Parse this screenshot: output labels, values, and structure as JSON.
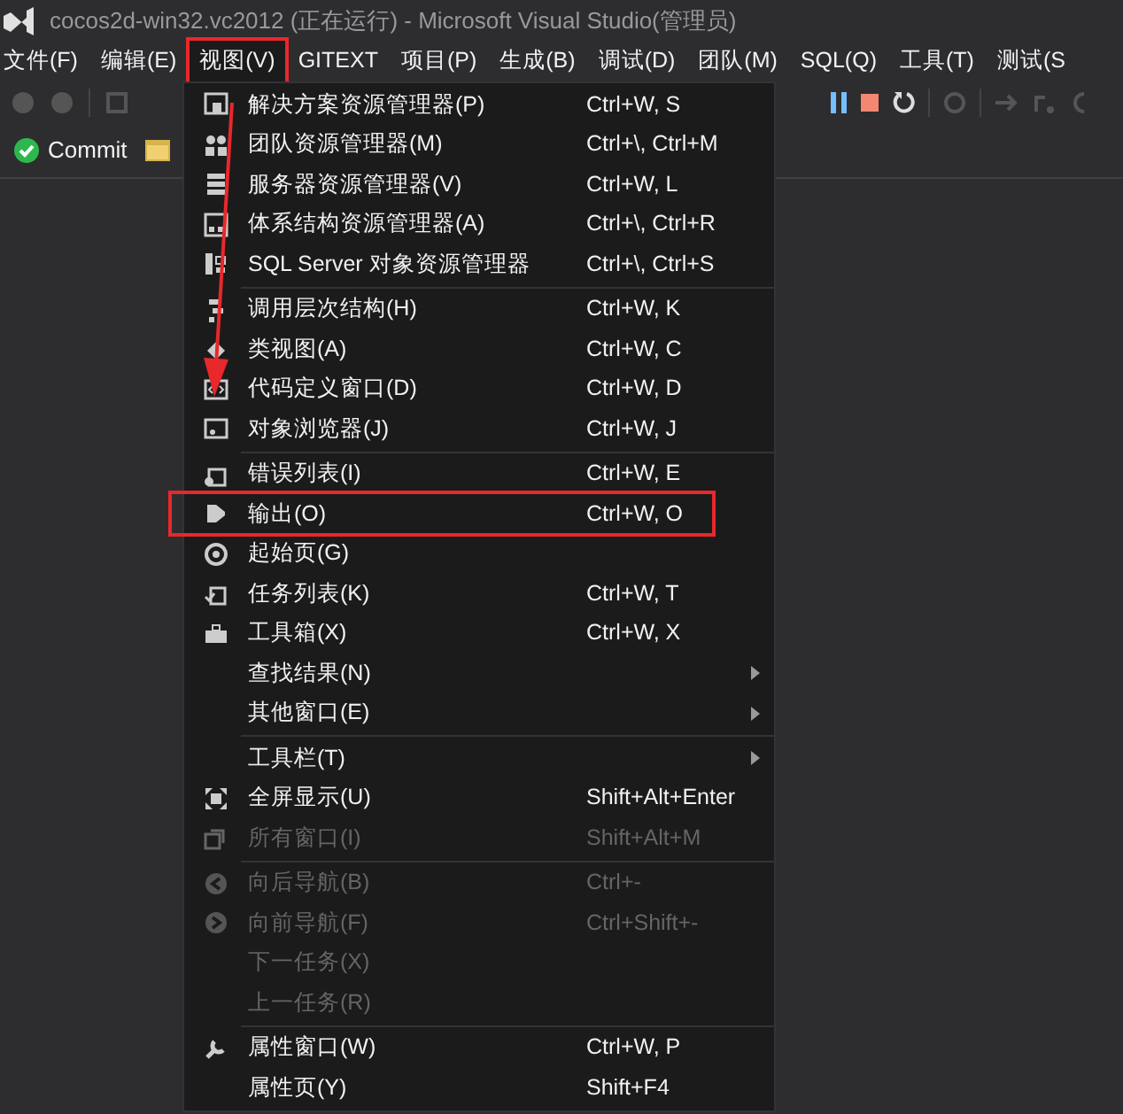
{
  "window": {
    "title": "cocos2d-win32.vc2012 (正在运行) - Microsoft Visual Studio(管理员)"
  },
  "menu_bar": [
    {
      "label": "文件(F)",
      "selected": false,
      "annotated": false
    },
    {
      "label": "编辑(E)",
      "selected": false,
      "annotated": false
    },
    {
      "label": "视图(V)",
      "selected": true,
      "annotated": true
    },
    {
      "label": "GITEXT",
      "selected": false,
      "annotated": false
    },
    {
      "label": "项目(P)",
      "selected": false,
      "annotated": false
    },
    {
      "label": "生成(B)",
      "selected": false,
      "annotated": false
    },
    {
      "label": "调试(D)",
      "selected": false,
      "annotated": false
    },
    {
      "label": "团队(M)",
      "selected": false,
      "annotated": false
    },
    {
      "label": "SQL(Q)",
      "selected": false,
      "annotated": false
    },
    {
      "label": "工具(T)",
      "selected": false,
      "annotated": false
    },
    {
      "label": "测试(S",
      "selected": false,
      "annotated": false
    }
  ],
  "toolbar": {
    "commit": "Commit"
  },
  "menu": {
    "items": [
      {
        "kind": "item",
        "label": "解决方案资源管理器(P)",
        "shortcut": "Ctrl+W, S",
        "disabled": false,
        "submenu": false,
        "annotated": false
      },
      {
        "kind": "item",
        "label": "团队资源管理器(M)",
        "shortcut": "Ctrl+\\, Ctrl+M",
        "disabled": false,
        "submenu": false,
        "annotated": false
      },
      {
        "kind": "item",
        "label": "服务器资源管理器(V)",
        "shortcut": "Ctrl+W, L",
        "disabled": false,
        "submenu": false,
        "annotated": false
      },
      {
        "kind": "item",
        "label": "体系结构资源管理器(A)",
        "shortcut": "Ctrl+\\, Ctrl+R",
        "disabled": false,
        "submenu": false,
        "annotated": false
      },
      {
        "kind": "item",
        "label": "SQL Server 对象资源管理器",
        "shortcut": "Ctrl+\\, Ctrl+S",
        "disabled": false,
        "submenu": false,
        "annotated": false
      },
      {
        "kind": "separator"
      },
      {
        "kind": "item",
        "label": "调用层次结构(H)",
        "shortcut": "Ctrl+W, K",
        "disabled": false,
        "submenu": false,
        "annotated": false
      },
      {
        "kind": "item",
        "label": "类视图(A)",
        "shortcut": "Ctrl+W, C",
        "disabled": false,
        "submenu": false,
        "annotated": false
      },
      {
        "kind": "item",
        "label": "代码定义窗口(D)",
        "shortcut": "Ctrl+W, D",
        "disabled": false,
        "submenu": false,
        "annotated": false
      },
      {
        "kind": "item",
        "label": "对象浏览器(J)",
        "shortcut": "Ctrl+W, J",
        "disabled": false,
        "submenu": false,
        "annotated": false
      },
      {
        "kind": "separator"
      },
      {
        "kind": "item",
        "label": "错误列表(I)",
        "shortcut": "Ctrl+W, E",
        "disabled": false,
        "submenu": false,
        "annotated": false
      },
      {
        "kind": "item",
        "label": "输出(O)",
        "shortcut": "Ctrl+W, O",
        "disabled": false,
        "submenu": false,
        "annotated": true
      },
      {
        "kind": "item",
        "label": "起始页(G)",
        "disabled": false,
        "submenu": false,
        "annotated": false
      },
      {
        "kind": "item",
        "label": "任务列表(K)",
        "shortcut": "Ctrl+W, T",
        "disabled": false,
        "submenu": false,
        "annotated": false
      },
      {
        "kind": "item",
        "label": "工具箱(X)",
        "shortcut": "Ctrl+W, X",
        "disabled": false,
        "submenu": false,
        "annotated": false
      },
      {
        "kind": "item",
        "label": "查找结果(N)",
        "disabled": false,
        "submenu": true,
        "annotated": false
      },
      {
        "kind": "item",
        "label": "其他窗口(E)",
        "disabled": false,
        "submenu": true,
        "annotated": false
      },
      {
        "kind": "separator"
      },
      {
        "kind": "item",
        "label": "工具栏(T)",
        "disabled": false,
        "submenu": true,
        "annotated": false
      },
      {
        "kind": "item",
        "label": "全屏显示(U)",
        "shortcut": "Shift+Alt+Enter",
        "disabled": false,
        "submenu": false,
        "annotated": false
      },
      {
        "kind": "item",
        "label": "所有窗口(I)",
        "shortcut": "Shift+Alt+M",
        "disabled": true,
        "submenu": false,
        "annotated": false
      },
      {
        "kind": "separator"
      },
      {
        "kind": "item",
        "label": "向后导航(B)",
        "shortcut": "Ctrl+-",
        "disabled": true,
        "submenu": false,
        "annotated": false
      },
      {
        "kind": "item",
        "label": "向前导航(F)",
        "shortcut": "Ctrl+Shift+-",
        "disabled": true,
        "submenu": false,
        "annotated": false
      },
      {
        "kind": "item",
        "label": "下一任务(X)",
        "disabled": true,
        "submenu": false,
        "annotated": false
      },
      {
        "kind": "item",
        "label": "上一任务(R)",
        "disabled": true,
        "submenu": false,
        "annotated": false
      },
      {
        "kind": "separator"
      },
      {
        "kind": "item",
        "label": "属性窗口(W)",
        "shortcut": "Ctrl+W, P",
        "disabled": false,
        "submenu": false,
        "annotated": false
      },
      {
        "kind": "item",
        "label": "属性页(Y)",
        "shortcut": "Shift+F4",
        "disabled": false,
        "submenu": false,
        "annotated": false
      }
    ]
  }
}
